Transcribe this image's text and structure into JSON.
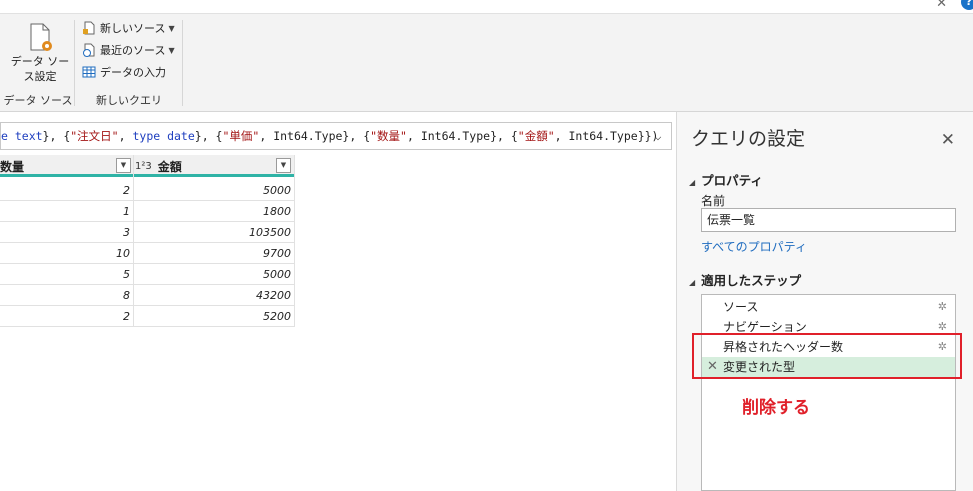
{
  "ribbon": {
    "datasource_button": "データ ソー\nス設定",
    "group1_label": "データ ソース",
    "new_source": "新しいソース",
    "recent_source": "最近のソース",
    "enter_data": "データの入力",
    "group2_label": "新しいクエリ"
  },
  "formula": {
    "tokens": [
      {
        "t": "e text",
        "c": "kw"
      },
      {
        "t": "}, {",
        "c": "plain"
      },
      {
        "t": "\"注文日\"",
        "c": "str"
      },
      {
        "t": ", ",
        "c": "plain"
      },
      {
        "t": "type date",
        "c": "kw"
      },
      {
        "t": "}, {",
        "c": "plain"
      },
      {
        "t": "\"単価\"",
        "c": "str"
      },
      {
        "t": ", Int64.Type}, {",
        "c": "plain"
      },
      {
        "t": "\"数量\"",
        "c": "str"
      },
      {
        "t": ", Int64.Type}, {",
        "c": "plain"
      },
      {
        "t": "\"金額\"",
        "c": "str"
      },
      {
        "t": ", Int64.Type}})",
        "c": "plain"
      }
    ]
  },
  "grid": {
    "col1_header": "数量",
    "col2_type_icon": "1²3",
    "col2_header": "金額",
    "rows": [
      {
        "qty": "2",
        "amount": "5000"
      },
      {
        "qty": "1",
        "amount": "1800"
      },
      {
        "qty": "3",
        "amount": "103500"
      },
      {
        "qty": "10",
        "amount": "9700"
      },
      {
        "qty": "5",
        "amount": "5000"
      },
      {
        "qty": "8",
        "amount": "43200"
      },
      {
        "qty": "2",
        "amount": "5200"
      }
    ]
  },
  "pane": {
    "title": "クエリの設定",
    "properties_title": "プロパティ",
    "name_label": "名前",
    "name_value": "伝票一覧",
    "all_properties": "すべてのプロパティ",
    "steps_title": "適用したステップ",
    "steps": [
      {
        "label": "ソース",
        "gear": true
      },
      {
        "label": "ナビゲーション",
        "gear": true
      },
      {
        "label": "昇格されたヘッダー数",
        "gear": true
      },
      {
        "label": "変更された型",
        "gear": false,
        "selected": true
      }
    ]
  },
  "annotation": "削除する",
  "colors": {
    "accent": "#2fb3a6",
    "annotation": "#e0202a",
    "selected_step": "#d6eedd",
    "link": "#1f6cbf"
  }
}
